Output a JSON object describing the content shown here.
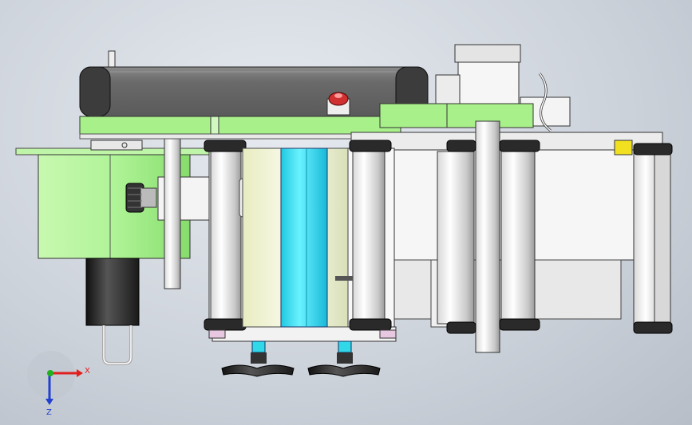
{
  "view": {
    "type": "cad-model-view",
    "model": "labeling-machine-assembly"
  },
  "triad": {
    "x_label": "X",
    "z_label": "Z",
    "x_color": "#e02020",
    "y_color": "#20b020",
    "z_color": "#2040d0"
  },
  "colors": {
    "background": "#d4d9e0",
    "green_part": "#a8f08a",
    "green_dark": "#78d860",
    "gray_housing": "#6e6e6e",
    "white_part": "#f4f4f4",
    "cyan_roller": "#34e0f0",
    "black_part": "#2a2a2a",
    "steel": "#b8b8b8"
  }
}
